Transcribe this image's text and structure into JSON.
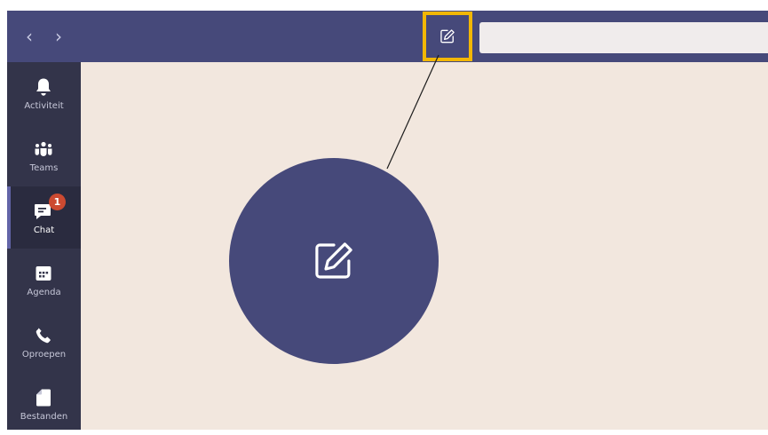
{
  "nav": {
    "back_glyph": "‹",
    "forward_glyph": "›"
  },
  "header": {
    "compose_icon": "new-chat-icon",
    "search_placeholder": ""
  },
  "sidebar": {
    "items": [
      {
        "label": "Activiteit",
        "icon": "bell-icon"
      },
      {
        "label": "Teams",
        "icon": "teams-icon"
      },
      {
        "label": "Chat",
        "icon": "chat-icon",
        "active": true,
        "badge": "1"
      },
      {
        "label": "Agenda",
        "icon": "calendar-icon"
      },
      {
        "label": "Oproepen",
        "icon": "phone-icon"
      },
      {
        "label": "Bestanden",
        "icon": "file-icon"
      }
    ]
  },
  "callout": {
    "icon": "new-chat-icon"
  },
  "colors": {
    "header": "#46497a",
    "rail": "#33344a",
    "content": "#f2e7de",
    "highlight": "#f2b705",
    "badge": "#cc4a31"
  }
}
